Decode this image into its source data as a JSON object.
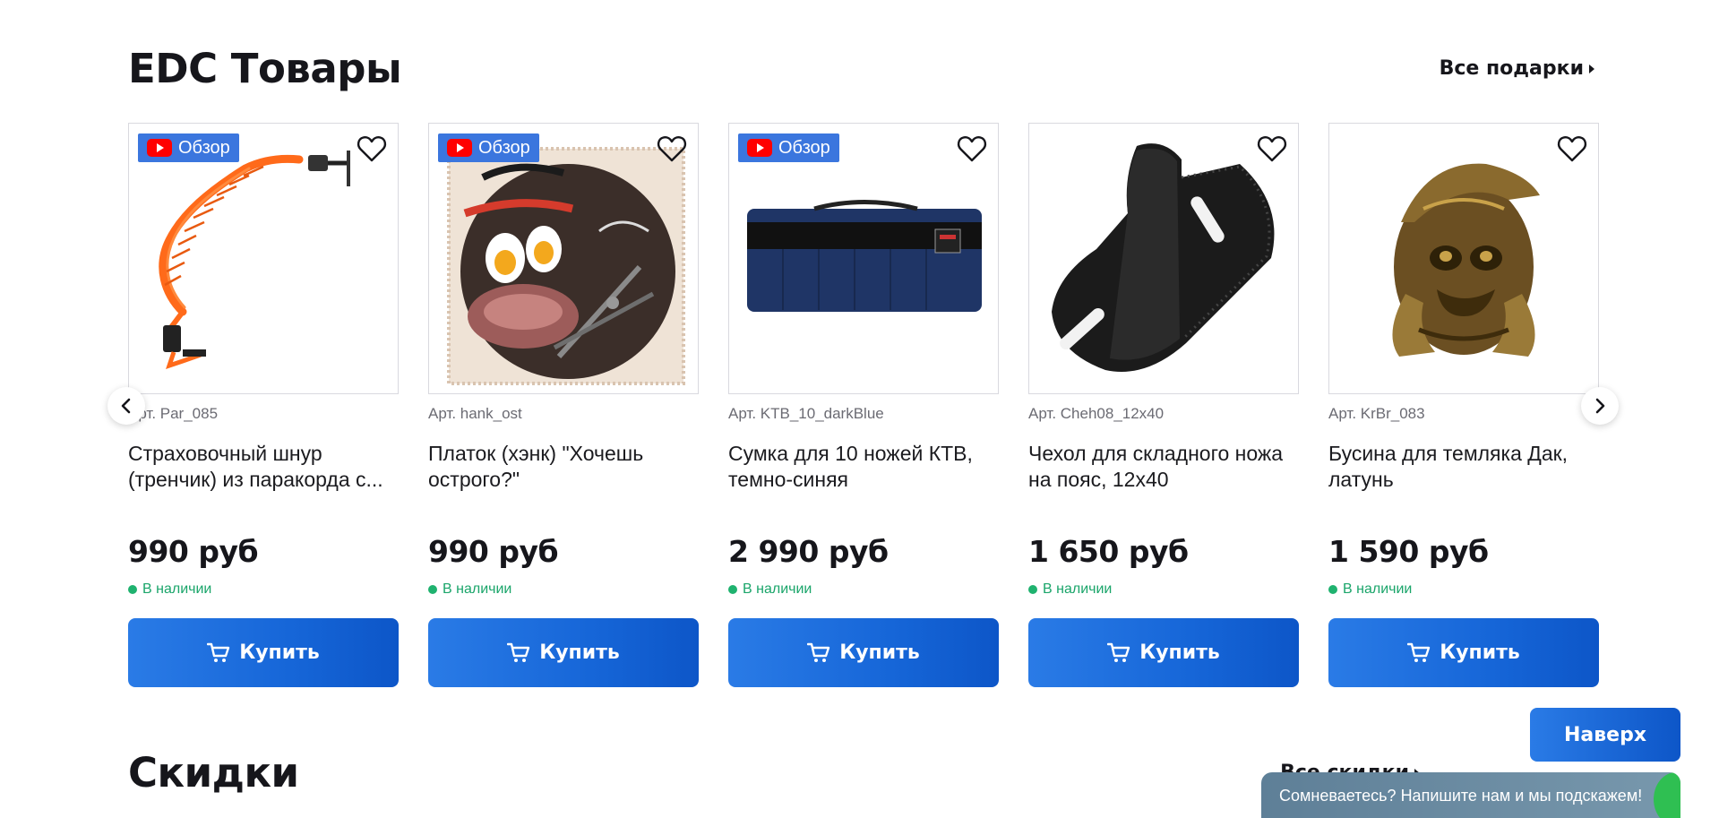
{
  "section_edc": {
    "title": "EDC Товары",
    "link": "Все подарки"
  },
  "section_sales": {
    "title": "Скидки",
    "link": "Все скидки"
  },
  "products": [
    {
      "article": "Арт. Par_085",
      "name": "Страховочный шнур (тренчик) из паракорда с...",
      "price": "990 руб",
      "stock": "В наличии",
      "buy": "Купить",
      "review": "Обзор",
      "image": "orange-coil-lanyard"
    },
    {
      "article": "Арт. hank_ost",
      "name": "Платок (хэнк) \"Хочешь острого?\"",
      "price": "990 руб",
      "stock": "В наличии",
      "buy": "Купить",
      "review": "Обзор",
      "image": "ramen-bandana"
    },
    {
      "article": "Арт. KTB_10_darkBlue",
      "name": "Сумка для 10 ножей КТВ, темно-синяя",
      "price": "2 990 руб",
      "stock": "В наличии",
      "buy": "Купить",
      "review": "Обзор",
      "image": "blue-knife-roll"
    },
    {
      "article": "Арт. Cheh08_12x40",
      "name": "Чехол для складного ножа на пояс, 12х40",
      "price": "1 650 руб",
      "stock": "В наличии",
      "buy": "Купить",
      "review": "",
      "image": "leather-sheath"
    },
    {
      "article": "Арт. KrBr_083",
      "name": "Бусина для темляка Дак, латунь",
      "price": "1 590 руб",
      "stock": "В наличии",
      "buy": "Купить",
      "review": "",
      "image": "brass-bead"
    }
  ],
  "buttons": {
    "to_top": "Наверх"
  },
  "chat": {
    "text": "Сомневаетесь? Напишите нам и мы подскажем!"
  },
  "colors": {
    "accent": "#1a6ee0",
    "stock_green": "#1fb26f",
    "chat_bg": "#6a8ba2"
  }
}
